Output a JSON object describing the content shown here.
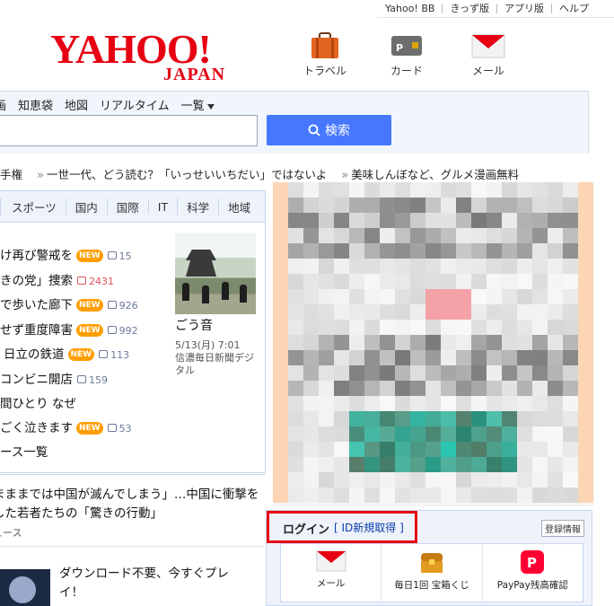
{
  "top_links": [
    "Yahoo! BB",
    "きっず版",
    "アプリ版",
    "ヘルプ"
  ],
  "logo": {
    "text": "YAHOO!",
    "sub": "JAPAN",
    "color": "#e60012"
  },
  "services": [
    {
      "label": "トラベル",
      "icon": "suitcase-icon"
    },
    {
      "label": "カード",
      "icon": "card-icon"
    },
    {
      "label": "メール",
      "icon": "mail-icon"
    }
  ],
  "categories": [
    "知恵袋",
    "地図",
    "リアルタイム",
    "一覧"
  ],
  "category_first_partial": "画",
  "search": {
    "value": "",
    "button_label": "検索",
    "accent": "#4577ff"
  },
  "trends": [
    {
      "text": "手権",
      "prefix": ""
    },
    {
      "text": "一世一代、どう読む？「いっせいいちだい」ではないよ"
    },
    {
      "text": "美味しんぼなど、グルメ漫画無料"
    }
  ],
  "news_tabs": [
    "スポーツ",
    "国内",
    "国際",
    "IT",
    "科学",
    "地域"
  ],
  "news": [
    {
      "title": "け再び警戒を",
      "new": true,
      "comments": "15"
    },
    {
      "title": "きの党」捜索",
      "new": false,
      "comments": "2431",
      "hot": true
    },
    {
      "title": "で歩いた廊下",
      "new": true,
      "comments": "926"
    },
    {
      "title": "せず重度障害",
      "new": true,
      "comments": "992"
    },
    {
      "title": "日立の鉄道",
      "new": true,
      "comments": "113"
    },
    {
      "title": "コンビニ開店",
      "new": false,
      "comments": "159"
    },
    {
      "title": "間ひとり なぜ",
      "new": false,
      "comments": ""
    },
    {
      "title": "ごく泣きます",
      "new": true,
      "comments": "53"
    },
    {
      "title": "ース一覧",
      "new": false,
      "comments": ""
    }
  ],
  "badge_label": "NEW",
  "photo": {
    "caption": "ごう音",
    "date": "5/13(月) 7:01",
    "source": "信濃毎日新聞デジタル"
  },
  "stories": [
    {
      "line1": "まままでは中国が滅んでしまう」…中国に衝撃を",
      "line2": "した若者たちの「驚きの行動」",
      "line3": "ュース"
    },
    {
      "line1": "ダウンロード不要、今すぐプレ",
      "line2": "イ！"
    }
  ],
  "login": {
    "title": "ログイン",
    "register": "[ ID新規取得 ]",
    "reg_info": "登録情報",
    "frame_color": "#e60012"
  },
  "login_services": [
    {
      "label": "メール",
      "icon": "mail-icon"
    },
    {
      "label": "毎日1回 宝箱くじ",
      "icon": "treasure-box-icon"
    },
    {
      "label": "PayPay残高確認",
      "icon": "paypay-icon"
    }
  ]
}
